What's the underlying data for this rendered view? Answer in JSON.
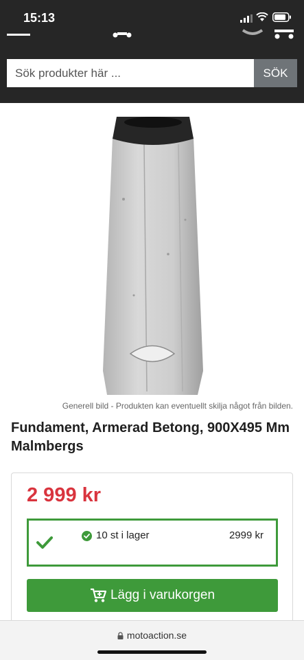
{
  "status_bar": {
    "time": "15:13"
  },
  "search": {
    "placeholder": "Sök produkter här ...",
    "button_label": "SÖK"
  },
  "product": {
    "image_caption": "Generell bild - Produkten kan eventuellt skilja något från bilden.",
    "title": "Fundament, Armerad Betong, 900X495 Mm Malmbergs",
    "price": "2 999 kr",
    "stock": {
      "quantity_text": "10 st i lager",
      "price": "2999 kr"
    },
    "add_to_cart_label": "Lägg i varukorgen"
  },
  "browser": {
    "url": "motoaction.se"
  },
  "colors": {
    "header_bg": "#262626",
    "price_red": "#d9343e",
    "accent_green": "#3e9a3a",
    "search_button": "#6f7478"
  },
  "icons": [
    "signal-icon",
    "wifi-icon",
    "battery-icon",
    "menu-icon",
    "logo-icon",
    "account-icon",
    "cart-icon",
    "check-icon",
    "lock-icon"
  ]
}
